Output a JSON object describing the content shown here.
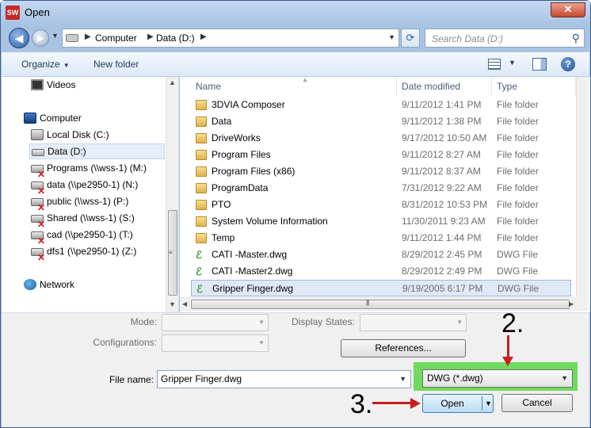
{
  "window": {
    "title": "Open",
    "app_icon_text": "SW",
    "close_glyph": "✕"
  },
  "navigation": {
    "back_icon": "back-arrow-icon",
    "forward_icon": "forward-arrow-icon",
    "path": [
      "Computer",
      "Data (D:)"
    ],
    "search_placeholder": "Search Data (D:)"
  },
  "toolbar": {
    "organize_label": "Organize",
    "new_folder_label": "New folder",
    "help_glyph": "?"
  },
  "sidebar": {
    "items": [
      {
        "label": "Videos",
        "icon": "video-library-icon"
      },
      {
        "label": "Computer",
        "icon": "computer-icon"
      },
      {
        "label": "Local Disk (C:)",
        "icon": "local-disk-icon"
      },
      {
        "label": "Data (D:)",
        "icon": "disk-drive-icon",
        "selected": true
      },
      {
        "label": "Programs (\\\\wss-1) (M:)",
        "icon": "network-drive-disconnected-icon"
      },
      {
        "label": "data (\\\\pe2950-1) (N:)",
        "icon": "network-drive-disconnected-icon"
      },
      {
        "label": "public (\\\\wss-1) (P:)",
        "icon": "network-drive-disconnected-icon"
      },
      {
        "label": "Shared (\\\\wss-1) (S:)",
        "icon": "network-drive-disconnected-icon"
      },
      {
        "label": "cad (\\\\pe2950-1) (T:)",
        "icon": "network-drive-disconnected-icon"
      },
      {
        "label": "dfs1 (\\\\pe2950-1) (Z:)",
        "icon": "network-drive-disconnected-icon"
      },
      {
        "label": "Network",
        "icon": "network-icon"
      }
    ]
  },
  "file_list": {
    "columns": [
      "Name",
      "Date modified",
      "Type"
    ],
    "rows": [
      {
        "name": "3DVIA Composer",
        "date": "9/11/2012 1:41 PM",
        "type": "File folder",
        "icon": "folder-icon"
      },
      {
        "name": "Data",
        "date": "9/11/2012 1:38 PM",
        "type": "File folder",
        "icon": "folder-icon"
      },
      {
        "name": "DriveWorks",
        "date": "9/17/2012 10:50 AM",
        "type": "File folder",
        "icon": "folder-icon"
      },
      {
        "name": "Program Files",
        "date": "9/11/2012 8:27 AM",
        "type": "File folder",
        "icon": "folder-icon"
      },
      {
        "name": "Program Files (x86)",
        "date": "9/11/2012 8:37 AM",
        "type": "File folder",
        "icon": "folder-icon"
      },
      {
        "name": "ProgramData",
        "date": "7/31/2012 9:22 AM",
        "type": "File folder",
        "icon": "folder-icon"
      },
      {
        "name": "PTO",
        "date": "8/31/2012 10:53 PM",
        "type": "File folder",
        "icon": "folder-icon"
      },
      {
        "name": "System Volume Information",
        "date": "11/30/2011 9:23 AM",
        "type": "File folder",
        "icon": "folder-icon"
      },
      {
        "name": "Temp",
        "date": "9/11/2012 1:44 PM",
        "type": "File folder",
        "icon": "folder-icon"
      },
      {
        "name": "CATI -Master.dwg",
        "date": "8/29/2012 2:45 PM",
        "type": "DWG File",
        "icon": "dwg-file-icon"
      },
      {
        "name": "CATI -Master2.dwg",
        "date": "8/29/2012 2:49 PM",
        "type": "DWG File",
        "icon": "dwg-file-icon"
      },
      {
        "name": "Gripper Finger.dwg",
        "date": "9/19/2005 6:17 PM",
        "type": "DWG File",
        "icon": "dwg-file-icon",
        "selected": true
      }
    ]
  },
  "options": {
    "mode_label": "Mode:",
    "configurations_label": "Configurations:",
    "display_states_label": "Display States:",
    "references_label": "References..."
  },
  "footer": {
    "file_name_label": "File name:",
    "file_name_value": "Gripper Finger.dwg",
    "file_type_value": "DWG (*.dwg)",
    "open_label": "Open",
    "cancel_label": "Cancel"
  },
  "annotations": {
    "step2": "2.",
    "step3": "3.",
    "arrow_color": "#c81e1e",
    "highlight_color": "#6fda5b"
  }
}
